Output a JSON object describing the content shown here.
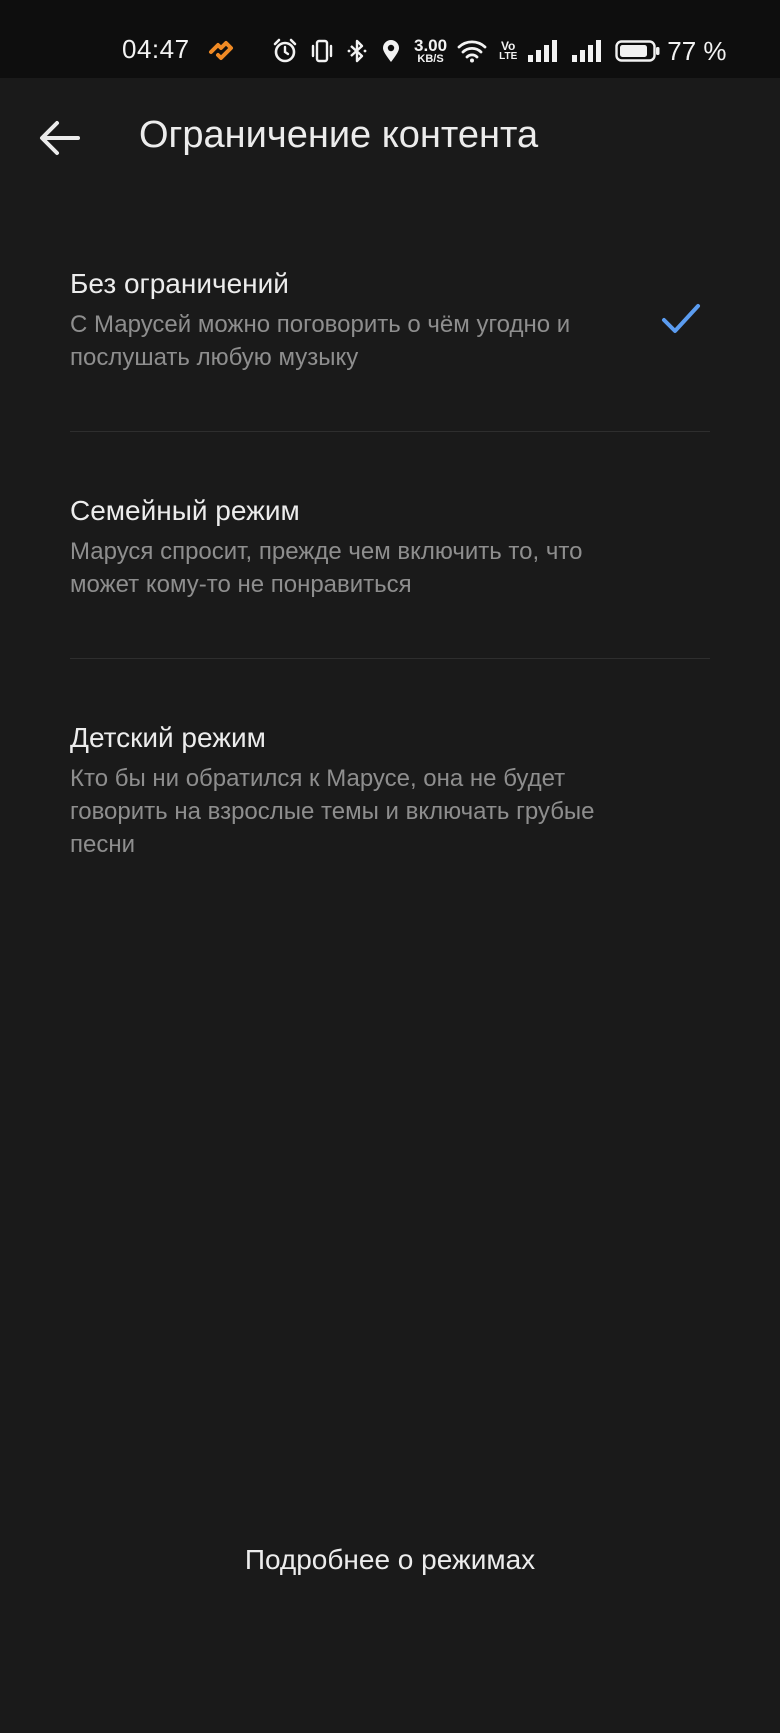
{
  "status_bar": {
    "time": "04:47",
    "net_speed_value": "3.00",
    "net_speed_unit": "KB/S",
    "volte_top": "Vo",
    "volte_bottom": "LTE",
    "battery_percent": "77 %",
    "app_icon_color": "#f08a24",
    "icons": [
      "alarm-icon",
      "vibrate-icon",
      "bluetooth-icon",
      "location-icon",
      "wifi-icon",
      "signal-icon",
      "signal-icon",
      "battery-icon"
    ]
  },
  "header": {
    "back_icon": "arrow-left-icon",
    "title": "Ограничение контента"
  },
  "options": [
    {
      "title": "Без ограничений",
      "description": "С Марусей можно поговорить о чём угодно и послушать любую музыку",
      "selected": true
    },
    {
      "title": "Семейный режим",
      "description": "Маруся спросит, прежде чем включить то, что может кому-то не понравиться",
      "selected": false
    },
    {
      "title": "Детский режим",
      "description": "Кто бы ни обратился к Марусе, она не будет говорить на взрослые темы и включать грубые песни",
      "selected": false
    }
  ],
  "footer": {
    "more_link": "Подробнее о режимах"
  },
  "colors": {
    "background": "#1a1a1a",
    "status_bar": "#0e0e0e",
    "accent_check": "#5b9cf0",
    "text_primary": "#ececec",
    "text_secondary": "#8e8e8e"
  }
}
